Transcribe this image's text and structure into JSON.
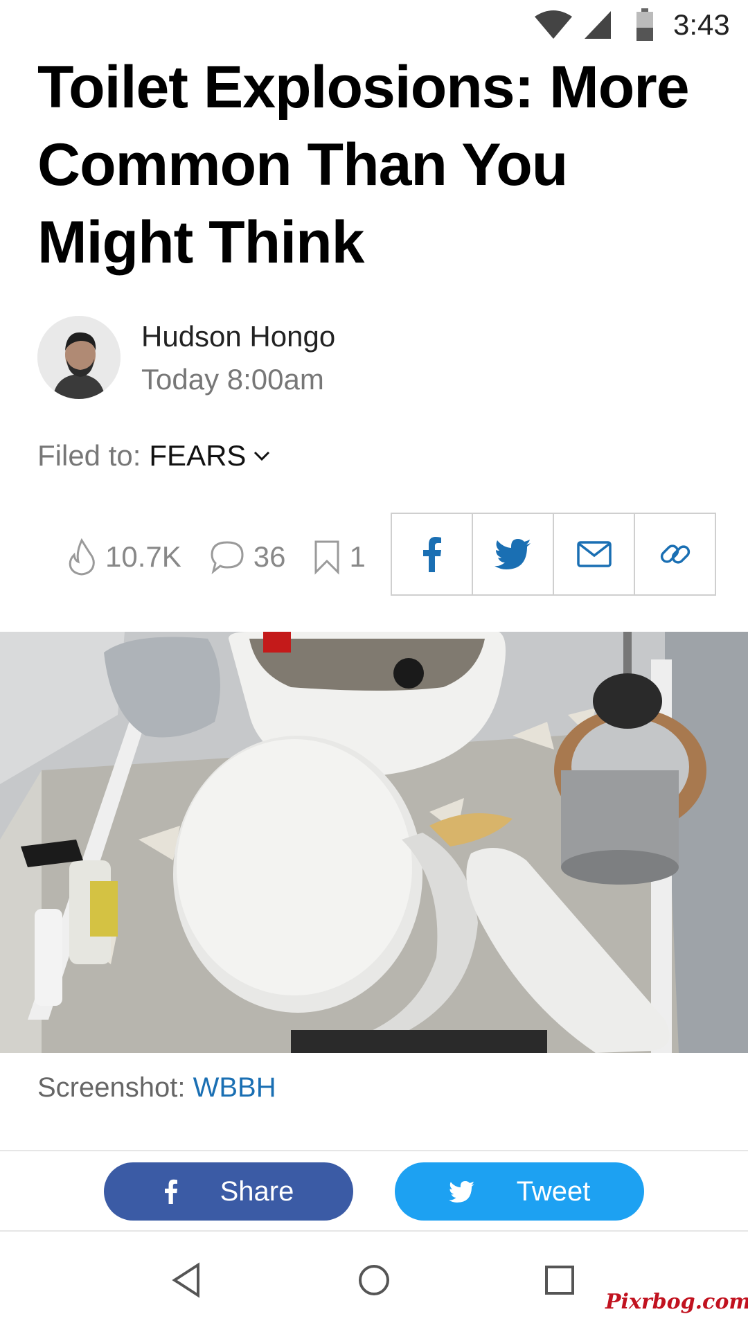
{
  "status_bar": {
    "time": "3:43",
    "icons": [
      "wifi-icon",
      "cell-signal-icon",
      "battery-icon"
    ]
  },
  "article": {
    "headline": "Toilet Explosions: More Common Than You Might Think",
    "author": "Hudson Hongo",
    "timestamp": "Today 8:00am",
    "filed_label": "Filed to:",
    "filed_tag": "FEARS"
  },
  "stats": {
    "views": "10.7K",
    "comments": "36",
    "saves": "1"
  },
  "share_icons": [
    "facebook-icon",
    "twitter-icon",
    "email-icon",
    "link-icon"
  ],
  "photo": {
    "caption_label": "Screenshot:",
    "caption_credit": "WBBH"
  },
  "bottom_bar": {
    "share_label": "Share",
    "tweet_label": "Tweet"
  },
  "nav_bar": {
    "icons": [
      "back-icon",
      "home-icon",
      "recents-icon"
    ]
  },
  "watermark": "Pixrbog.com",
  "colors": {
    "facebook_blue": "#3b5ba5",
    "twitter_blue": "#1da1f2",
    "link_blue": "#1a6fb3",
    "share_icon_blue": "#1a6fb3",
    "watermark_red": "#c1121f"
  }
}
